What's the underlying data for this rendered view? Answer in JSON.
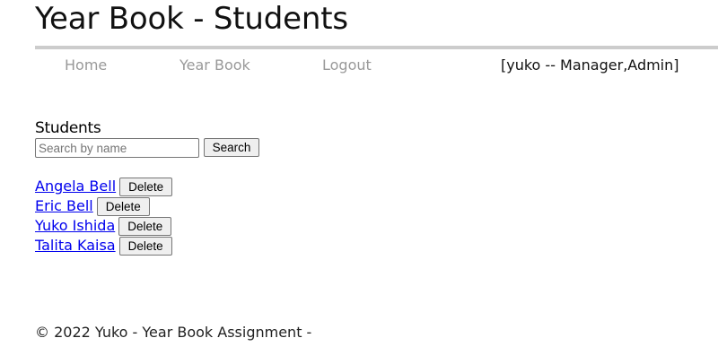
{
  "header": {
    "title": "Year Book - Students"
  },
  "nav": {
    "home_label": "Home",
    "yearbook_label": "Year Book",
    "logout_label": "Logout",
    "user_info": "[yuko -- Manager,Admin]"
  },
  "main": {
    "heading": "Students",
    "search_placeholder": "Search by name",
    "search_value": "",
    "search_button_label": "Search",
    "delete_label": "Delete",
    "students": [
      {
        "name": "Angela Bell"
      },
      {
        "name": "Eric Bell"
      },
      {
        "name": "Yuko Ishida"
      },
      {
        "name": "Talita Kaisa"
      }
    ]
  },
  "footer": {
    "text": "© 2022 Yuko - Year Book Assignment -"
  },
  "colors": {
    "link": "#0000ee",
    "nav_text": "#999999",
    "rule": "#cccccc"
  }
}
